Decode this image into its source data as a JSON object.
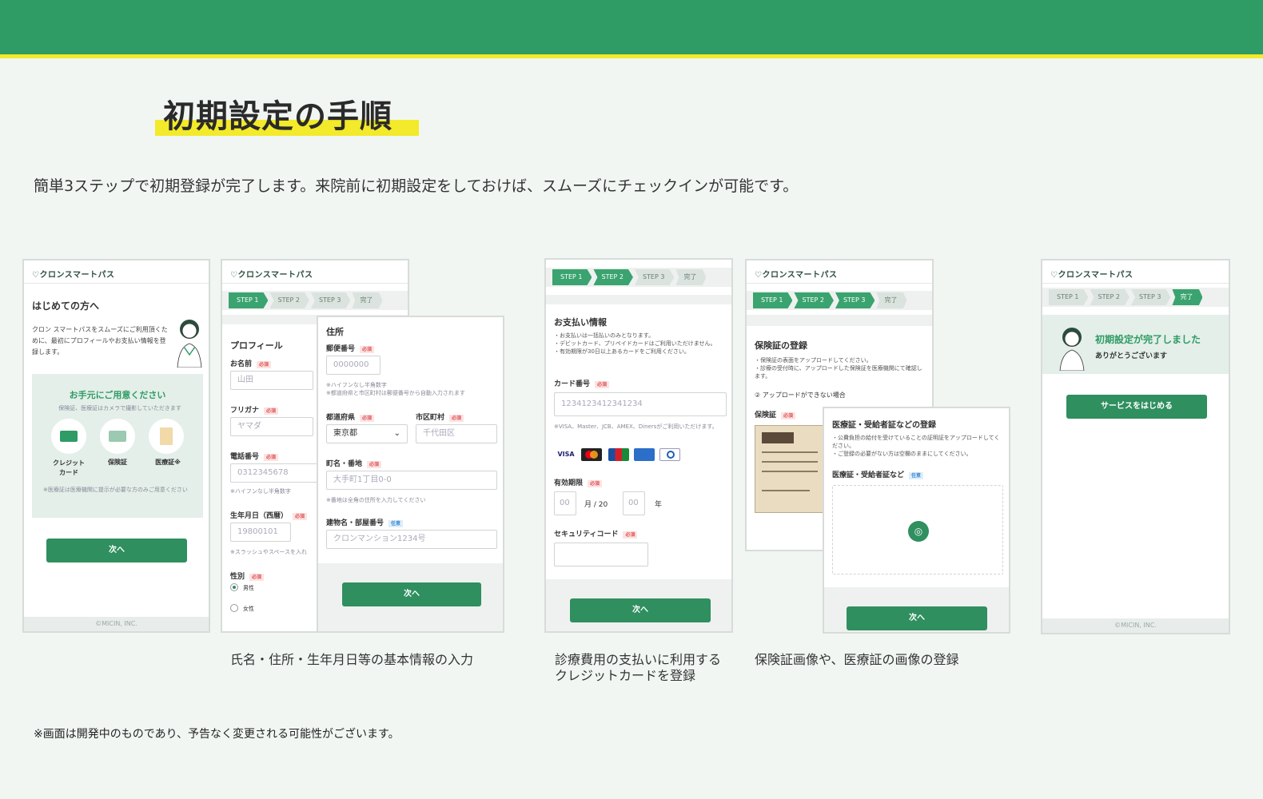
{
  "page": {
    "title": "初期設定の手順",
    "lead": "簡単3ステップで初期登録が完了します。来院前に初期設定をしておけば、スムーズにチェックインが可能です。",
    "note": "※画面は開発中のものであり、予告なく変更される可能性がございます。",
    "captions": {
      "step1": "氏名・住所・生年月日等の基本情報の入力",
      "step2": "診療費用の支払いに利用する\nクレジットカードを登録",
      "step3": "保険証画像や、医療証の画像の登録"
    }
  },
  "common": {
    "logo": "♡クロンスマートパス",
    "footer": "©MICIN, INC.",
    "next": "次へ",
    "required": "必須",
    "optional": "任意",
    "steps": [
      "STEP 1",
      "STEP 2",
      "STEP 3",
      "完了"
    ]
  },
  "intro": {
    "heading": "はじめての方へ",
    "body": "クロン スマートパスをスムーズにご利用頂くために、最初にプロフィールやお支払い情報を登録します。",
    "box_title": "お手元にご用意ください",
    "box_sub": "保険証、医療証はカメラで撮影していただきます",
    "items": [
      "クレジット\nカード",
      "保険証",
      "医療証※"
    ],
    "box_note": "※医療証は医療機関に提示が必要な方のみご用意ください"
  },
  "profile": {
    "heading": "プロフィール",
    "name_label": "お名前",
    "name_ph": "山田",
    "kana_label": "フリガナ",
    "kana_ph": "ヤマダ",
    "tel_label": "電話番号",
    "tel_ph": "0312345678",
    "tel_hint": "※ハイフンなし半角数字",
    "birth_label": "生年月日（西暦）",
    "birth_ph": "19800101",
    "birth_hint": "※スラッシュやスペースを入れ",
    "gender_label": "性別",
    "male": "男性",
    "female": "女性"
  },
  "address": {
    "heading": "住所",
    "zip_label": "郵便番号",
    "zip_ph": "0000000",
    "zip_hint": "※ハイフンなし半角数字\n※都道府県と市区町村は郵便番号から自動入力されます",
    "pref_label": "都道府県",
    "pref_value": "東京都",
    "city_label": "市区町村",
    "city_ph": "千代田区",
    "street_label": "町名・番地",
    "street_ph": "大手町1丁目0-0",
    "street_hint": "※番地は全角の住所を入力してください",
    "bldg_label": "建物名・部屋番号",
    "bldg_ph": "クロンマンション1234号"
  },
  "payment": {
    "heading": "お支払い情報",
    "notes": "・お支払いは一括払いのみとなります。\n・デビットカード、プリペイドカードはご利用いただけません。\n・有効期限が30日以上あるカードをご利用ください。",
    "card_label": "カード番号",
    "card_ph": "1234123412341234",
    "card_hint": "※VISA、Master、JCB、AMEX、Dinersがご利用いただけます。",
    "brands": [
      "VISA",
      "Mastercard",
      "JCB",
      "AMEX",
      "Diners"
    ],
    "exp_label": "有効期限",
    "exp_month": "00",
    "exp_mid": "月 /  20",
    "exp_year": "00",
    "exp_end": "年",
    "cvc_label": "セキュリティコード"
  },
  "insurance": {
    "heading": "保険証の登録",
    "notes": "・保険証の表面をアップロードしてください。\n・診療の受付時に、アップロードした保険証を医療機関にて確認します。",
    "help": "② アップロードができない場合",
    "card_label": "保険証"
  },
  "medical": {
    "heading": "医療証・受給者証などの登録",
    "notes": "・公費負担の給付を受けていることの証明証をアップロードしてください。\n・ご登録の必要がない方は空欄のままにしてください。",
    "label": "医療証・受給者証など"
  },
  "complete": {
    "title": "初期設定が完了しました",
    "sub": "ありがとうございます",
    "button": "サービスをはじめる"
  },
  "colors": {
    "brand": "#2f9b65",
    "accent": "#f2ea2a",
    "button": "#2f8f5f"
  }
}
